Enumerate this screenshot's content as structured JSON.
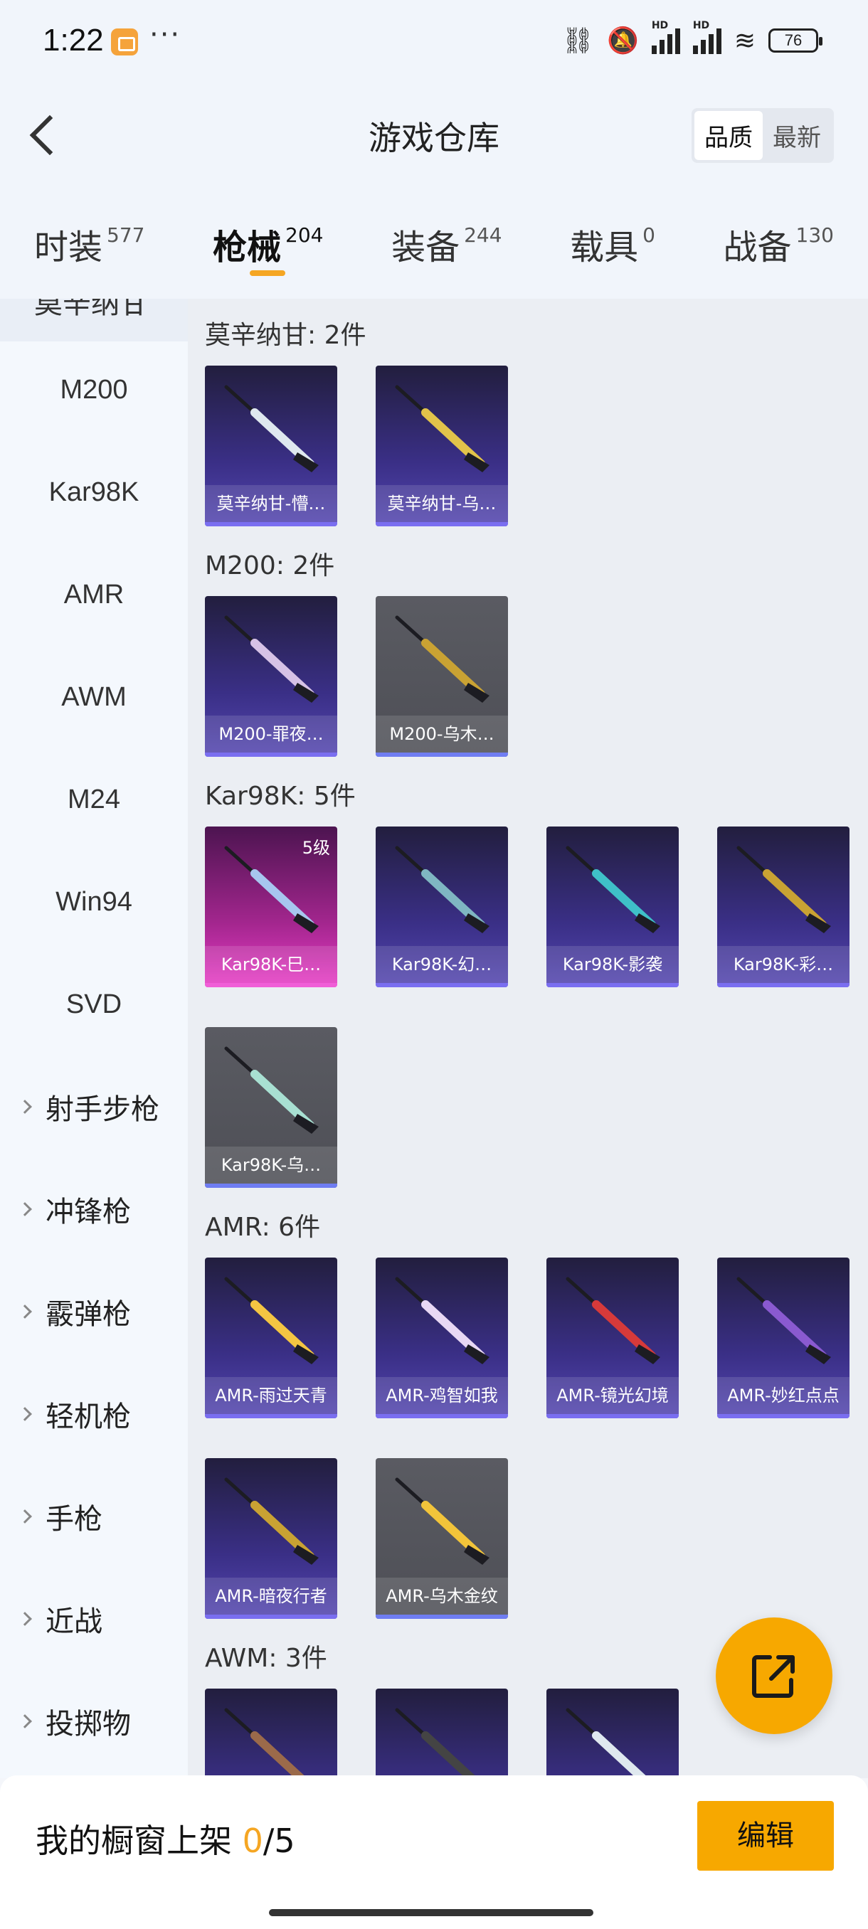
{
  "status_bar": {
    "time": "1:22",
    "dots": "···",
    "battery": "76"
  },
  "header": {
    "title": "游戏仓库",
    "sort_options": [
      "品质",
      "最新"
    ]
  },
  "tabs": [
    {
      "label": "时装",
      "count": "577"
    },
    {
      "label": "枪械",
      "count": "204"
    },
    {
      "label": "装备",
      "count": "244"
    },
    {
      "label": "载具",
      "count": "0"
    },
    {
      "label": "战备",
      "count": "130"
    }
  ],
  "sidebar": {
    "cut_off_item": "莫辛纳甘",
    "sub_items": [
      "M200",
      "Kar98K",
      "AMR",
      "AWM",
      "M24",
      "Win94",
      "SVD"
    ],
    "categories": [
      "射手步枪",
      "冲锋枪",
      "霰弹枪",
      "轻机枪",
      "手枪",
      "近战",
      "投掷物"
    ]
  },
  "groups": [
    {
      "title": "莫辛纳甘: 2件",
      "items": [
        {
          "name": "莫辛纳甘-懵…",
          "color": "purple"
        },
        {
          "name": "莫辛纳甘-乌…",
          "color": "purple"
        }
      ]
    },
    {
      "title": "M200: 2件",
      "items": [
        {
          "name": "M200-罪夜…",
          "color": "purple"
        },
        {
          "name": "M200-乌木…",
          "color": "gray"
        }
      ]
    },
    {
      "title": "Kar98K: 5件",
      "items": [
        {
          "name": "Kar98K-巳…",
          "color": "pink",
          "level": "5级"
        },
        {
          "name": "Kar98K-幻…",
          "color": "purple"
        },
        {
          "name": "Kar98K-影袭",
          "color": "purple"
        },
        {
          "name": "Kar98K-彩…",
          "color": "purple"
        },
        {
          "name": "Kar98K-乌…",
          "color": "gray"
        }
      ]
    },
    {
      "title": "AMR: 6件",
      "items": [
        {
          "name": "AMR-雨过天青",
          "color": "purple"
        },
        {
          "name": "AMR-鸡智如我",
          "color": "purple"
        },
        {
          "name": "AMR-镜光幻境",
          "color": "purple"
        },
        {
          "name": "AMR-妙红点点",
          "color": "purple"
        },
        {
          "name": "AMR-暗夜行者",
          "color": "purple"
        },
        {
          "name": "AMR-乌木金纹",
          "color": "gray"
        }
      ]
    },
    {
      "title": "AWM: 3件",
      "items": [
        {
          "name": "",
          "color": "purple"
        },
        {
          "name": "",
          "color": "purple"
        },
        {
          "name": "",
          "color": "purple"
        }
      ]
    }
  ],
  "bottom": {
    "label": "我的橱窗上架 ",
    "shown": "0",
    "total": "/5",
    "edit": "编辑"
  }
}
